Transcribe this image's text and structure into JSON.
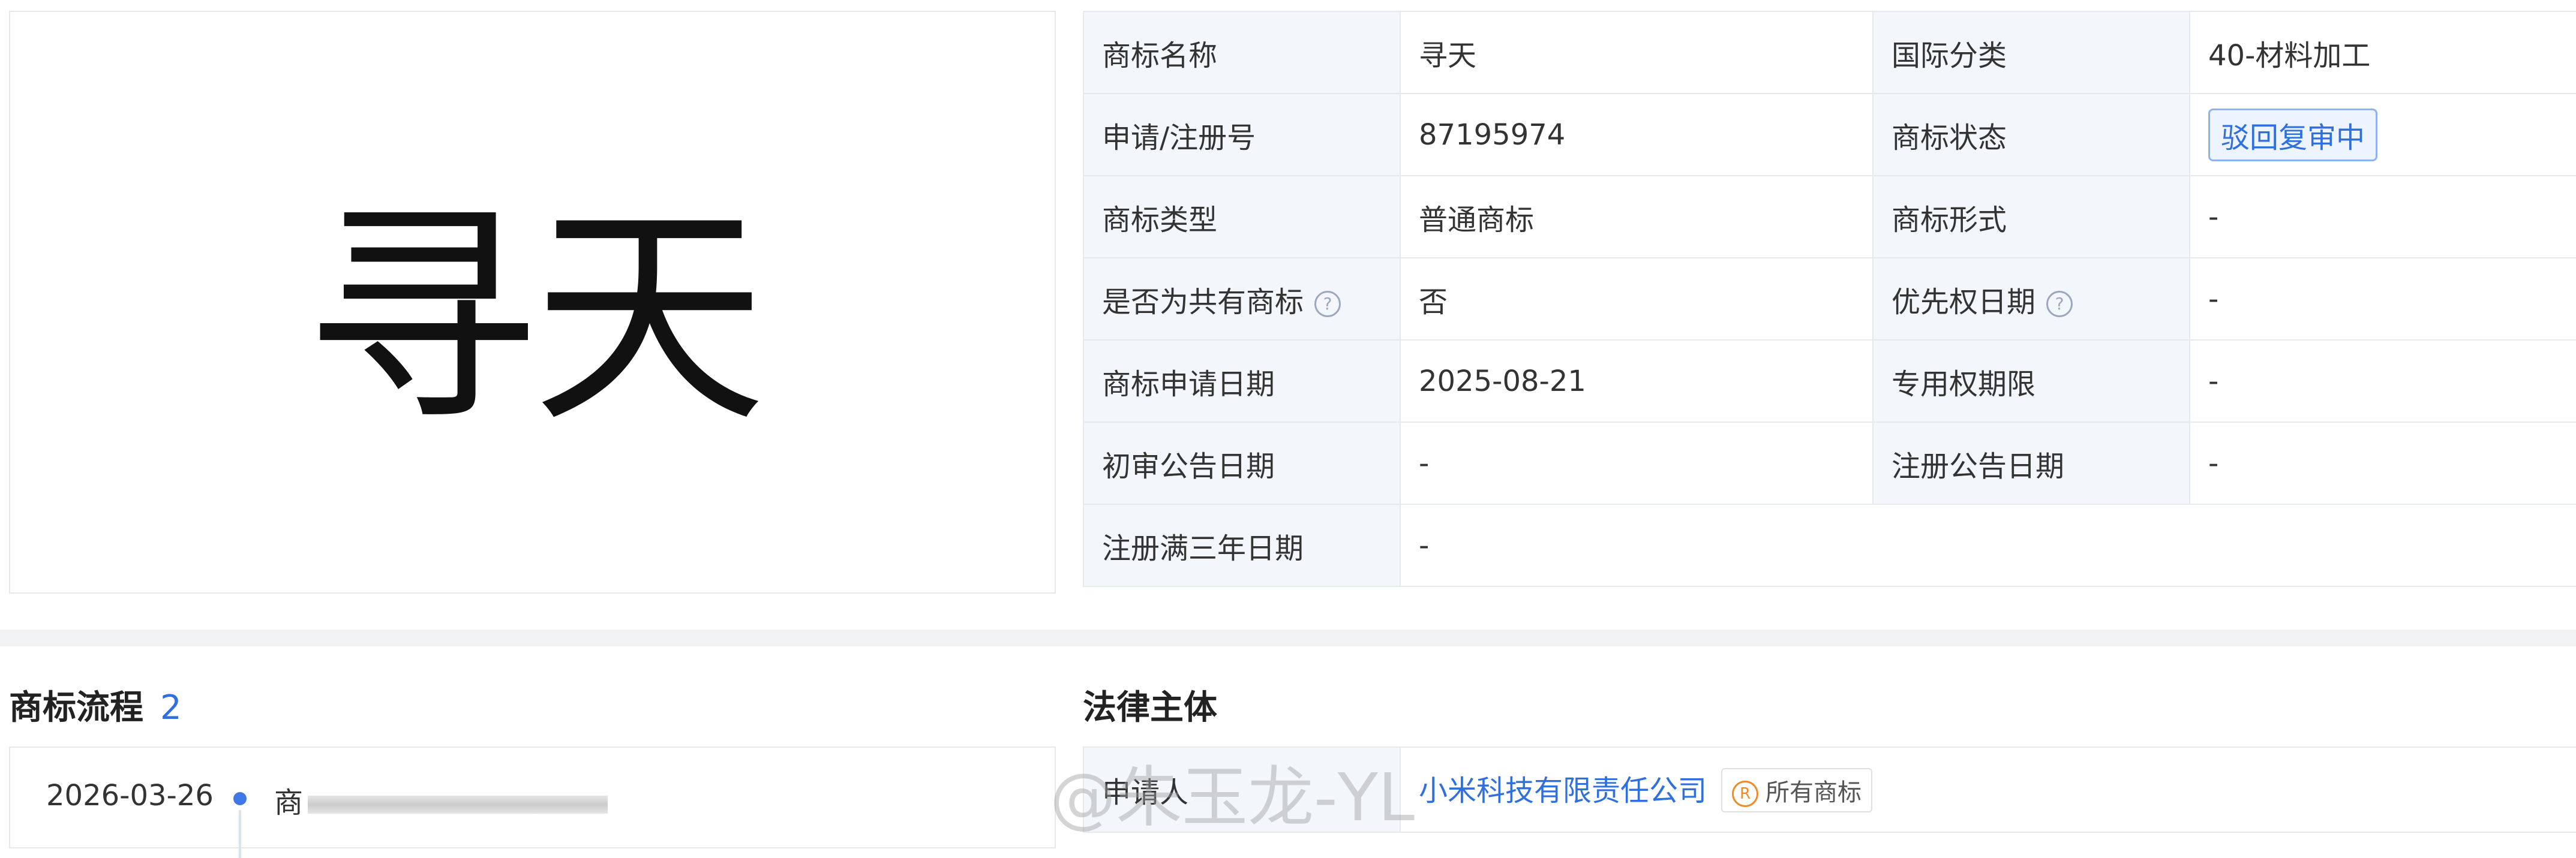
{
  "trademark_image": {
    "text": "寻天"
  },
  "info": {
    "rows": [
      {
        "l1": "商标名称",
        "v1": "寻天",
        "l2": "国际分类",
        "v2": "40-材料加工"
      },
      {
        "l1": "申请/注册号",
        "v1": "87195974",
        "l2": "商标状态",
        "v2": "驳回复审中"
      },
      {
        "l1": "商标类型",
        "v1": "普通商标",
        "l2": "商标形式",
        "v2": "-"
      },
      {
        "l1": "是否为共有商标",
        "v1": "否",
        "l2": "优先权日期",
        "v2": "-"
      },
      {
        "l1": "商标申请日期",
        "v1": "2025-08-21",
        "l2": "专用权期限",
        "v2": "-"
      },
      {
        "l1": "初审公告日期",
        "v1": "-",
        "l2": "注册公告日期",
        "v2": "-"
      },
      {
        "l1": "注册满三年日期",
        "v1": "-"
      }
    ],
    "help_icon_glyph": "?",
    "status_color": "#2f6fe0"
  },
  "process": {
    "title": "商标流程",
    "count": "2",
    "items": [
      {
        "date": "2026-03-26",
        "desc": "商"
      }
    ]
  },
  "legal": {
    "title": "法律主体",
    "applicant_label": "申请人",
    "company": "小米科技有限责任公司",
    "badge_icon": "R",
    "badge_label": "所有商标"
  },
  "watermark": "@朱玉龙-YL"
}
